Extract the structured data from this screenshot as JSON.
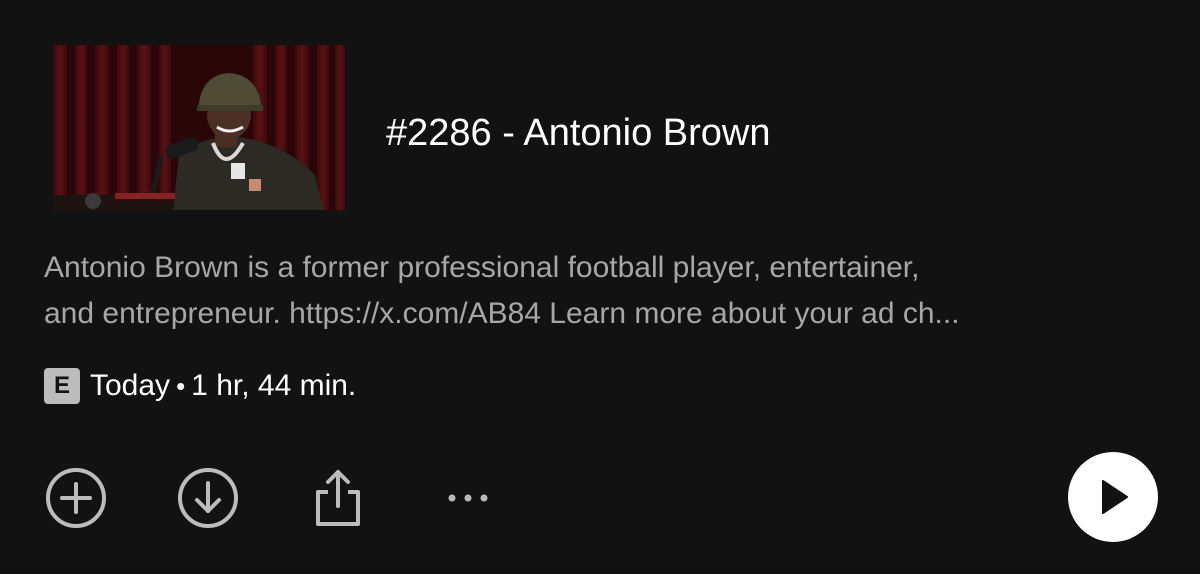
{
  "episode": {
    "title": "#2286 - Antonio Brown",
    "description_line1": "Antonio Brown is a former professional football player, entertainer,",
    "description_line2": "and entrepreneur. https://x.com/AB84 Learn more about your ad ch...",
    "explicit_label": "E",
    "date": "Today",
    "separator": "•",
    "duration": "1 hr, 44 min."
  },
  "actions": {
    "add_icon": "plus-circle-icon",
    "download_icon": "download-circle-icon",
    "share_icon": "share-icon",
    "more_icon": "more-horizontal-icon",
    "play_icon": "play-icon"
  },
  "colors": {
    "background": "#121212",
    "title": "#ffffff",
    "description": "#a7a7a7",
    "icon": "#bcbcbc",
    "play_button": "#ffffff"
  }
}
